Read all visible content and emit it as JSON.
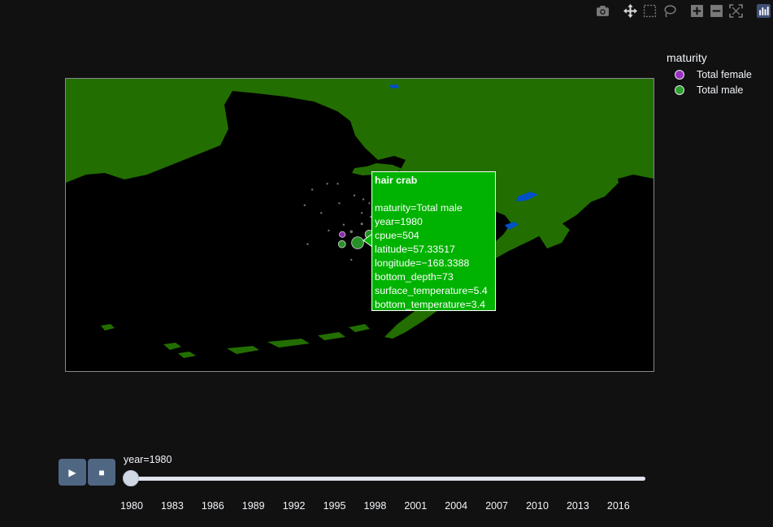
{
  "modebar": {
    "buttons": [
      "camera-icon",
      "pan-icon",
      "box-select-icon",
      "lasso-select-icon",
      "zoom-in-icon",
      "zoom-out-icon",
      "autoscale-icon",
      "plotly-logo-icon"
    ]
  },
  "legend": {
    "title": "maturity",
    "items": [
      {
        "label": "Total female",
        "color": "#9b30c4"
      },
      {
        "label": "Total male",
        "color": "#2ca02c"
      }
    ]
  },
  "colors": {
    "background": "#111111",
    "ocean": "#000000",
    "land": "#236e00",
    "lakes": "#0050c8",
    "female": "#9b30c4",
    "male": "#2ca02c",
    "tooltip_bg": "#00b300",
    "button": "#506784"
  },
  "tooltip": {
    "title": "hair crab",
    "lines": [
      "maturity=Total male",
      "year=1980",
      "cpue=504",
      "latitude=57.33517",
      "longitude=−168.3388",
      "bottom_depth=73",
      "surface_temperature=5.4",
      "bottom_temperature=3.4"
    ]
  },
  "controls": {
    "play_icon": "▶",
    "stop_icon": "■"
  },
  "slider": {
    "label": "year=1980",
    "current": "1980",
    "ticks": [
      "1980",
      "1983",
      "1986",
      "1989",
      "1992",
      "1995",
      "1998",
      "2001",
      "2004",
      "2007",
      "2010",
      "2013",
      "2016"
    ]
  },
  "chart_data": {
    "type": "scatter",
    "subtype": "scattergeo",
    "legend_title": "maturity",
    "legend_position": "top-right",
    "series": [
      {
        "name": "Total female",
        "color": "#9b30c4",
        "points": [
          {
            "longitude": -168.85,
            "latitude": 57.55,
            "cpue": 120
          }
        ]
      },
      {
        "name": "Total male",
        "color": "#2ca02c",
        "points": [
          {
            "longitude": -168.3388,
            "latitude": 57.33517,
            "cpue": 504,
            "bottom_depth": 73,
            "surface_temperature": 5.4,
            "bottom_temperature": 3.4
          },
          {
            "longitude": -168.86,
            "latitude": 57.3,
            "cpue": 180
          },
          {
            "longitude": -167.95,
            "latitude": 57.55,
            "cpue": 260
          },
          {
            "longitude": -168.55,
            "latitude": 57.62,
            "cpue": 30
          },
          {
            "longitude": -168.2,
            "latitude": 57.82,
            "cpue": 20
          },
          {
            "longitude": -167.9,
            "latitude": 58.0,
            "cpue": 10
          },
          {
            "longitude": -168.2,
            "latitude": 58.1,
            "cpue": 8
          },
          {
            "longitude": -167.95,
            "latitude": 58.35,
            "cpue": 6
          },
          {
            "longitude": -168.95,
            "latitude": 58.35,
            "cpue": 4
          },
          {
            "longitude": -169.55,
            "latitude": 58.1,
            "cpue": 4
          },
          {
            "longitude": -167.65,
            "latitude": 57.2,
            "cpue": 8
          },
          {
            "longitude": -168.55,
            "latitude": 56.9,
            "cpue": 6
          },
          {
            "longitude": -167.7,
            "latitude": 56.95,
            "cpue": 4
          },
          {
            "longitude": -170.0,
            "latitude": 57.3,
            "cpue": 3
          },
          {
            "longitude": -169.85,
            "latitude": 58.7,
            "cpue": 3
          },
          {
            "longitude": -169.35,
            "latitude": 58.85,
            "cpue": 3
          },
          {
            "longitude": -169.0,
            "latitude": 58.85,
            "cpue": 3
          },
          {
            "longitude": -168.45,
            "latitude": 58.55,
            "cpue": 3
          },
          {
            "longitude": -168.15,
            "latitude": 58.45,
            "cpue": 3
          },
          {
            "longitude": -167.85,
            "latitude": 58.55,
            "cpue": 3
          },
          {
            "longitude": -167.55,
            "latitude": 58.2,
            "cpue": 3
          },
          {
            "longitude": -167.55,
            "latitude": 57.85,
            "cpue": 3
          },
          {
            "longitude": -168.8,
            "latitude": 57.8,
            "cpue": 3
          },
          {
            "longitude": -169.3,
            "latitude": 57.65,
            "cpue": 3
          },
          {
            "longitude": -170.1,
            "latitude": 58.3,
            "cpue": 3
          }
        ]
      }
    ]
  }
}
